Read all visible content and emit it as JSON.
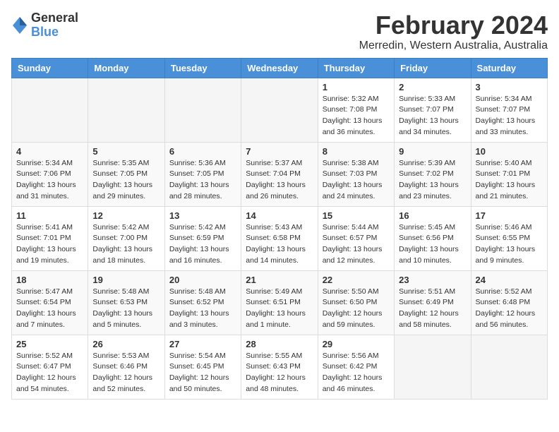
{
  "header": {
    "logo_general": "General",
    "logo_blue": "Blue",
    "title": "February 2024",
    "subtitle": "Merredin, Western Australia, Australia"
  },
  "calendar": {
    "days_of_week": [
      "Sunday",
      "Monday",
      "Tuesday",
      "Wednesday",
      "Thursday",
      "Friday",
      "Saturday"
    ],
    "weeks": [
      [
        {
          "day": "",
          "info": ""
        },
        {
          "day": "",
          "info": ""
        },
        {
          "day": "",
          "info": ""
        },
        {
          "day": "",
          "info": ""
        },
        {
          "day": "1",
          "info": "Sunrise: 5:32 AM\nSunset: 7:08 PM\nDaylight: 13 hours\nand 36 minutes."
        },
        {
          "day": "2",
          "info": "Sunrise: 5:33 AM\nSunset: 7:07 PM\nDaylight: 13 hours\nand 34 minutes."
        },
        {
          "day": "3",
          "info": "Sunrise: 5:34 AM\nSunset: 7:07 PM\nDaylight: 13 hours\nand 33 minutes."
        }
      ],
      [
        {
          "day": "4",
          "info": "Sunrise: 5:34 AM\nSunset: 7:06 PM\nDaylight: 13 hours\nand 31 minutes."
        },
        {
          "day": "5",
          "info": "Sunrise: 5:35 AM\nSunset: 7:05 PM\nDaylight: 13 hours\nand 29 minutes."
        },
        {
          "day": "6",
          "info": "Sunrise: 5:36 AM\nSunset: 7:05 PM\nDaylight: 13 hours\nand 28 minutes."
        },
        {
          "day": "7",
          "info": "Sunrise: 5:37 AM\nSunset: 7:04 PM\nDaylight: 13 hours\nand 26 minutes."
        },
        {
          "day": "8",
          "info": "Sunrise: 5:38 AM\nSunset: 7:03 PM\nDaylight: 13 hours\nand 24 minutes."
        },
        {
          "day": "9",
          "info": "Sunrise: 5:39 AM\nSunset: 7:02 PM\nDaylight: 13 hours\nand 23 minutes."
        },
        {
          "day": "10",
          "info": "Sunrise: 5:40 AM\nSunset: 7:01 PM\nDaylight: 13 hours\nand 21 minutes."
        }
      ],
      [
        {
          "day": "11",
          "info": "Sunrise: 5:41 AM\nSunset: 7:01 PM\nDaylight: 13 hours\nand 19 minutes."
        },
        {
          "day": "12",
          "info": "Sunrise: 5:42 AM\nSunset: 7:00 PM\nDaylight: 13 hours\nand 18 minutes."
        },
        {
          "day": "13",
          "info": "Sunrise: 5:42 AM\nSunset: 6:59 PM\nDaylight: 13 hours\nand 16 minutes."
        },
        {
          "day": "14",
          "info": "Sunrise: 5:43 AM\nSunset: 6:58 PM\nDaylight: 13 hours\nand 14 minutes."
        },
        {
          "day": "15",
          "info": "Sunrise: 5:44 AM\nSunset: 6:57 PM\nDaylight: 13 hours\nand 12 minutes."
        },
        {
          "day": "16",
          "info": "Sunrise: 5:45 AM\nSunset: 6:56 PM\nDaylight: 13 hours\nand 10 minutes."
        },
        {
          "day": "17",
          "info": "Sunrise: 5:46 AM\nSunset: 6:55 PM\nDaylight: 13 hours\nand 9 minutes."
        }
      ],
      [
        {
          "day": "18",
          "info": "Sunrise: 5:47 AM\nSunset: 6:54 PM\nDaylight: 13 hours\nand 7 minutes."
        },
        {
          "day": "19",
          "info": "Sunrise: 5:48 AM\nSunset: 6:53 PM\nDaylight: 13 hours\nand 5 minutes."
        },
        {
          "day": "20",
          "info": "Sunrise: 5:48 AM\nSunset: 6:52 PM\nDaylight: 13 hours\nand 3 minutes."
        },
        {
          "day": "21",
          "info": "Sunrise: 5:49 AM\nSunset: 6:51 PM\nDaylight: 13 hours\nand 1 minute."
        },
        {
          "day": "22",
          "info": "Sunrise: 5:50 AM\nSunset: 6:50 PM\nDaylight: 12 hours\nand 59 minutes."
        },
        {
          "day": "23",
          "info": "Sunrise: 5:51 AM\nSunset: 6:49 PM\nDaylight: 12 hours\nand 58 minutes."
        },
        {
          "day": "24",
          "info": "Sunrise: 5:52 AM\nSunset: 6:48 PM\nDaylight: 12 hours\nand 56 minutes."
        }
      ],
      [
        {
          "day": "25",
          "info": "Sunrise: 5:52 AM\nSunset: 6:47 PM\nDaylight: 12 hours\nand 54 minutes."
        },
        {
          "day": "26",
          "info": "Sunrise: 5:53 AM\nSunset: 6:46 PM\nDaylight: 12 hours\nand 52 minutes."
        },
        {
          "day": "27",
          "info": "Sunrise: 5:54 AM\nSunset: 6:45 PM\nDaylight: 12 hours\nand 50 minutes."
        },
        {
          "day": "28",
          "info": "Sunrise: 5:55 AM\nSunset: 6:43 PM\nDaylight: 12 hours\nand 48 minutes."
        },
        {
          "day": "29",
          "info": "Sunrise: 5:56 AM\nSunset: 6:42 PM\nDaylight: 12 hours\nand 46 minutes."
        },
        {
          "day": "",
          "info": ""
        },
        {
          "day": "",
          "info": ""
        }
      ]
    ]
  }
}
